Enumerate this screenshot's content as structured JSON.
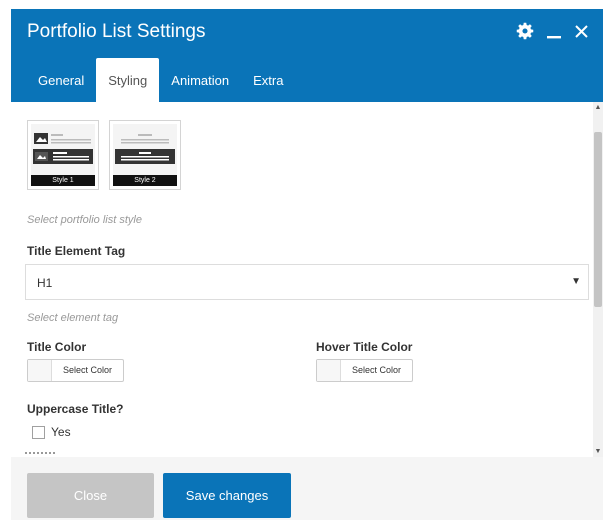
{
  "window": {
    "title": "Portfolio List Settings",
    "icons": [
      "gear-icon",
      "minimize-icon",
      "close-icon"
    ]
  },
  "tabs": [
    {
      "label": "General",
      "active": false
    },
    {
      "label": "Styling",
      "active": true
    },
    {
      "label": "Animation",
      "active": false
    },
    {
      "label": "Extra",
      "active": false
    }
  ],
  "styling": {
    "style_options": [
      {
        "caption": "Style 1"
      },
      {
        "caption": "Style 2"
      }
    ],
    "style_hint": "Select portfolio list style",
    "title_tag": {
      "label": "Title Element Tag",
      "value": "H1",
      "hint": "Select element tag"
    },
    "title_color": {
      "label": "Title Color",
      "button": "Select Color"
    },
    "hover_title_color": {
      "label": "Hover Title Color",
      "button": "Select Color"
    },
    "uppercase": {
      "label": "Uppercase Title?",
      "option": "Yes",
      "checked": false
    }
  },
  "footer": {
    "close_label": "Close",
    "save_label": "Save changes"
  },
  "colors": {
    "accent": "#0a74b8",
    "close_button": "#c5c5c5",
    "footer_bg": "#f5f5f5"
  }
}
